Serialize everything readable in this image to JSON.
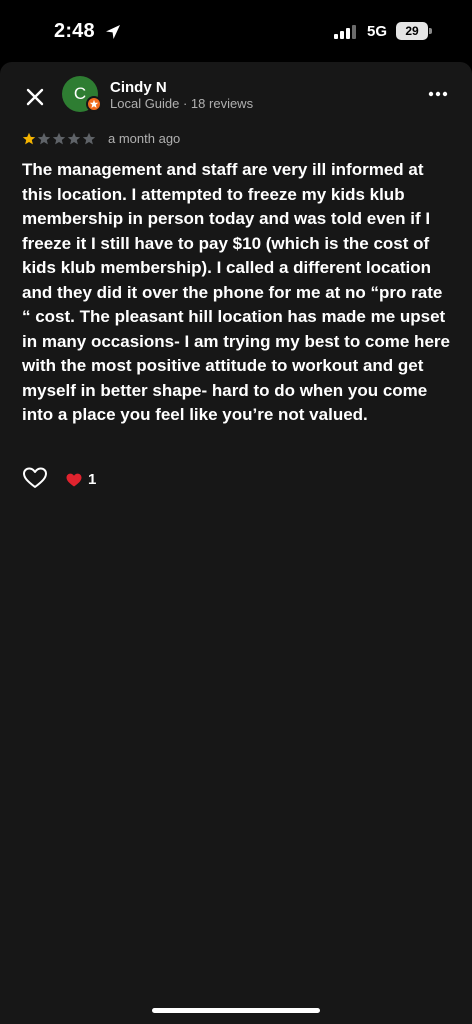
{
  "status_bar": {
    "time": "2:48",
    "network": "5G",
    "battery": "29"
  },
  "review": {
    "avatar_initial": "C",
    "user_name": "Cindy N",
    "user_meta": "Local Guide · 18 reviews",
    "rating": 1,
    "rating_max": 5,
    "date": "a month ago",
    "text": "The management and staff are very ill informed at this location. I attempted to freeze my kids klub membership in person today and was told even if I freeze it I still have to pay $10 (which is the cost of kids klub membership). I called a different location and they did it over the phone for me at no “pro rate “ cost. The pleasant hill location has made me upset in many occasions- I am trying my best to come here with the most positive attitude to workout and get myself in better shape- hard to do when you come into a place you feel like you’re not valued.",
    "reaction_count": "1"
  },
  "icons": {
    "close": "close-icon",
    "more": "more-icon",
    "like": "heart-outline-icon",
    "reaction": "heart-icon",
    "guide_badge": "local-guide-star-icon"
  },
  "colors": {
    "star_filled": "#f5b400",
    "star_empty": "#5f6368",
    "avatar_bg": "#2e7d32",
    "badge_bg": "#f26b1d",
    "reaction_heart": "#e0232e"
  }
}
